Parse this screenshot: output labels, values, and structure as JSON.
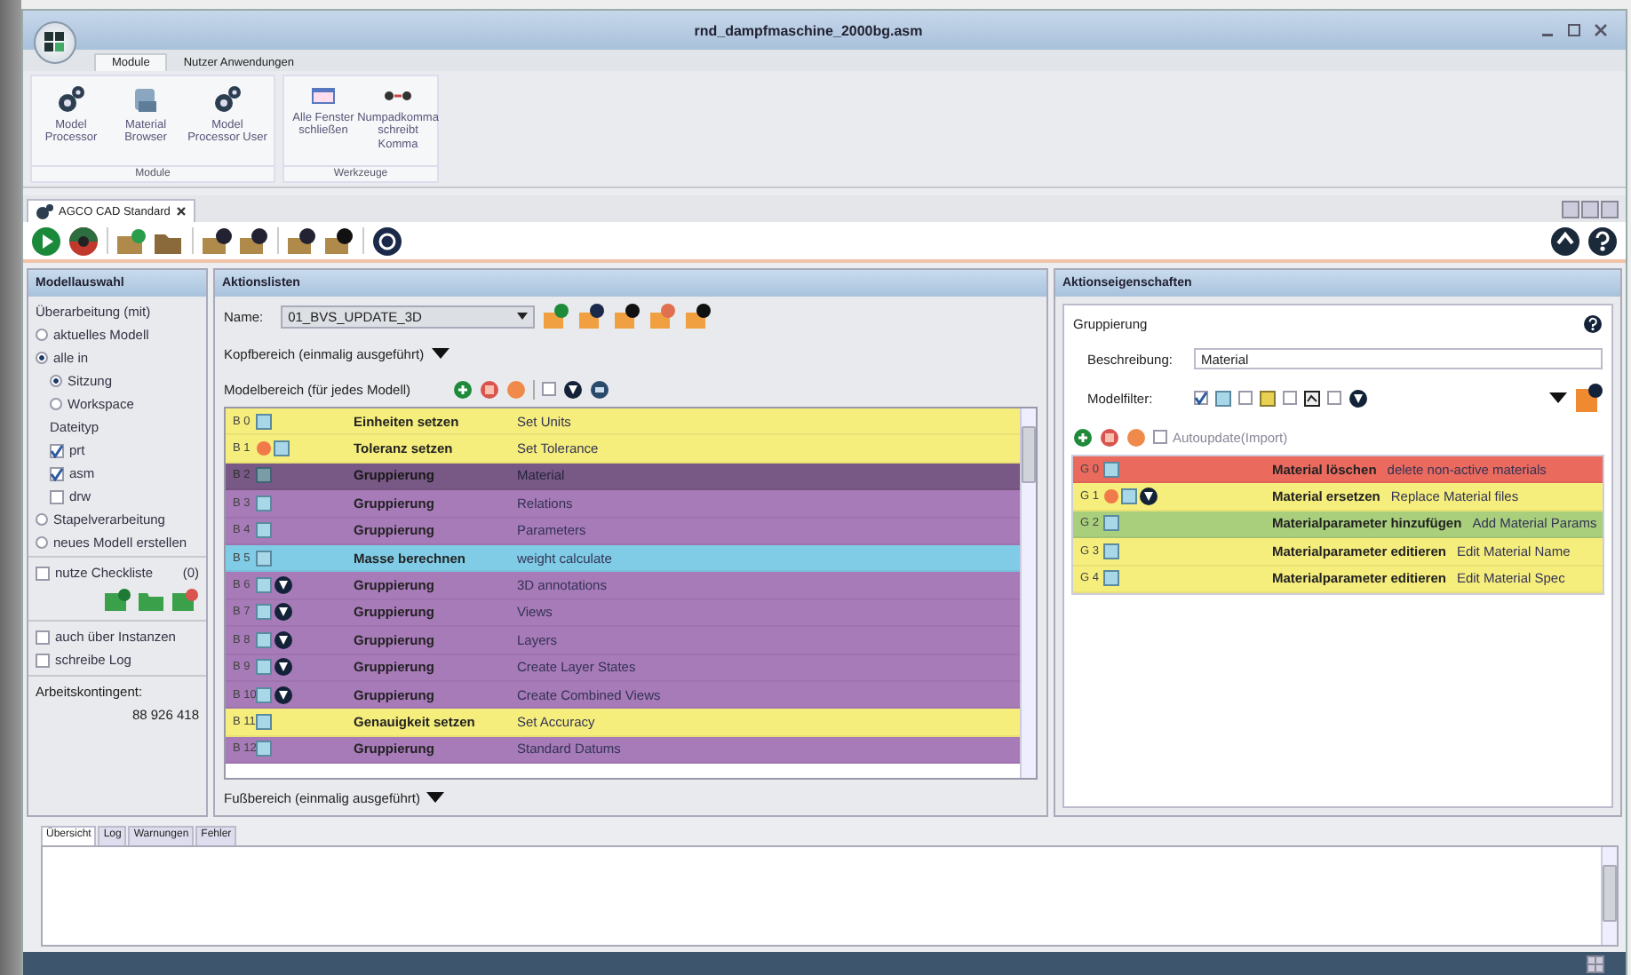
{
  "window": {
    "title": "rnd_dampfmaschine_2000bg.asm"
  },
  "ribbon_tabs": [
    {
      "label": "Module",
      "selected": true
    },
    {
      "label": "Nutzer Anwendungen",
      "selected": false
    }
  ],
  "ribbon_groups": [
    {
      "label": "Module",
      "buttons": [
        {
          "label": "Model Processor"
        },
        {
          "label": "Material Browser"
        },
        {
          "label": "Model Processor User"
        }
      ]
    },
    {
      "label": "Werkzeuge",
      "buttons": [
        {
          "label": "Alle Fenster schließen"
        },
        {
          "label": "Numpadkomma schreibt Komma"
        }
      ]
    }
  ],
  "document_tab": {
    "label": "AGCO CAD Standard"
  },
  "left_panel": {
    "title": "Modellauswahl",
    "section_label": "Überarbeitung (mit)",
    "options": [
      {
        "label": "aktuelles Modell",
        "selected": false
      },
      {
        "label": "alle in",
        "selected": true,
        "children": [
          {
            "label": "Sitzung",
            "selected": true
          },
          {
            "label": "Workspace",
            "selected": false
          }
        ]
      }
    ],
    "filetype_label": "Dateityp",
    "filetypes": [
      {
        "label": "prt",
        "checked": true
      },
      {
        "label": "asm",
        "checked": true
      },
      {
        "label": "drw",
        "checked": false
      }
    ],
    "more_options": [
      {
        "label": "Stapelverarbeitung",
        "selected": false
      },
      {
        "label": "neues Modell erstellen",
        "selected": false
      }
    ],
    "checklist": {
      "label": "nutze Checkliste",
      "count": "(0)",
      "checked": false
    },
    "extra_options": [
      {
        "label": "auch über Instanzen",
        "checked": false
      },
      {
        "label": "schreibe Log",
        "checked": false
      }
    ],
    "quota_label": "Arbeitskontingent:",
    "quota_value": "88 926 418"
  },
  "action_lists": {
    "title": "Aktionslisten",
    "name_label": "Name:",
    "name_value": "01_BVS_UPDATE_3D",
    "header_section": "Kopfbereich (einmalig ausgeführt)",
    "model_section": "Modelbereich (für jedes Modell)",
    "footer_section": "Fußbereich (einmalig ausgeführt)",
    "filter_checkbox": {
      "checked": false
    },
    "rows": [
      {
        "id": "B 0",
        "title": "Einheiten setzen",
        "desc": "Set Units",
        "color": "#f6ee7c",
        "selected": false,
        "warning": false,
        "filter": false
      },
      {
        "id": "B 1",
        "title": "Toleranz setzen",
        "desc": "Set Tolerance",
        "color": "#f6ee7c",
        "selected": false,
        "warning": true,
        "filter": false
      },
      {
        "id": "B 2",
        "title": "Gruppierung",
        "desc": "Material",
        "color": "#a77ab8",
        "selected": true,
        "warning": false,
        "filter": false
      },
      {
        "id": "B 3",
        "title": "Gruppierung",
        "desc": "Relations",
        "color": "#a77ab8",
        "selected": false,
        "warning": false,
        "filter": false
      },
      {
        "id": "B 4",
        "title": "Gruppierung",
        "desc": "Parameters",
        "color": "#a77ab8",
        "selected": false,
        "warning": false,
        "filter": false
      },
      {
        "id": "B 5",
        "title": "Masse berechnen",
        "desc": "weight calculate",
        "color": "#80cce6",
        "selected": false,
        "warning": false,
        "filter": false
      },
      {
        "id": "B 6",
        "title": "Gruppierung",
        "desc": "3D annotations",
        "color": "#a77ab8",
        "selected": false,
        "warning": false,
        "filter": true
      },
      {
        "id": "B 7",
        "title": "Gruppierung",
        "desc": "Views",
        "color": "#a77ab8",
        "selected": false,
        "warning": false,
        "filter": true
      },
      {
        "id": "B 8",
        "title": "Gruppierung",
        "desc": "Layers",
        "color": "#a77ab8",
        "selected": false,
        "warning": false,
        "filter": true
      },
      {
        "id": "B 9",
        "title": "Gruppierung",
        "desc": "Create Layer States",
        "color": "#a77ab8",
        "selected": false,
        "warning": false,
        "filter": true
      },
      {
        "id": "B 10",
        "title": "Gruppierung",
        "desc": "Create Combined Views",
        "color": "#a77ab8",
        "selected": false,
        "warning": false,
        "filter": true
      },
      {
        "id": "B 11",
        "title": "Genauigkeit setzen",
        "desc": "Set Accuracy",
        "color": "#f6ee7c",
        "selected": false,
        "warning": false,
        "filter": false
      },
      {
        "id": "B 12",
        "title": "Gruppierung",
        "desc": "Standard Datums",
        "color": "#a77ab8",
        "selected": false,
        "warning": false,
        "filter": false
      }
    ]
  },
  "properties": {
    "title": "Aktionseigenschaften",
    "type_label": "Gruppierung",
    "description_label": "Beschreibung:",
    "description_value": "Material",
    "filter_label": "Modelfilter:",
    "filter_checks": [
      {
        "checked": true
      },
      {
        "checked": false
      },
      {
        "checked": false
      },
      {
        "checked": false
      }
    ],
    "autoupdate": {
      "label": "Autoupdate(Import)",
      "checked": false
    },
    "rows": [
      {
        "id": "G 0",
        "title": "Material löschen",
        "desc": "delete non-active materials",
        "color": "#ea6a5e",
        "selected": false,
        "warning": false,
        "filter": false
      },
      {
        "id": "G 1",
        "title": "Material ersetzen",
        "desc": "Replace Material files",
        "color": "#f6ee7c",
        "selected": false,
        "warning": true,
        "filter": true
      },
      {
        "id": "G 2",
        "title": "Materialparameter hinzufügen",
        "desc": "Add Material Params",
        "color": "#a9cf7c",
        "selected": false,
        "warning": false,
        "filter": false
      },
      {
        "id": "G 3",
        "title": "Materialparameter editieren",
        "desc": "Edit Material Name",
        "color": "#f6ee7c",
        "selected": false,
        "warning": false,
        "filter": false
      },
      {
        "id": "G 4",
        "title": "Materialparameter editieren",
        "desc": "Edit Material Spec",
        "color": "#f6ee7c",
        "selected": false,
        "warning": false,
        "filter": false
      }
    ]
  },
  "bottom_tabs": [
    {
      "label": "Übersicht",
      "selected": true
    },
    {
      "label": "Log",
      "selected": false
    },
    {
      "label": "Warnungen",
      "selected": false
    },
    {
      "label": "Fehler",
      "selected": false
    }
  ]
}
